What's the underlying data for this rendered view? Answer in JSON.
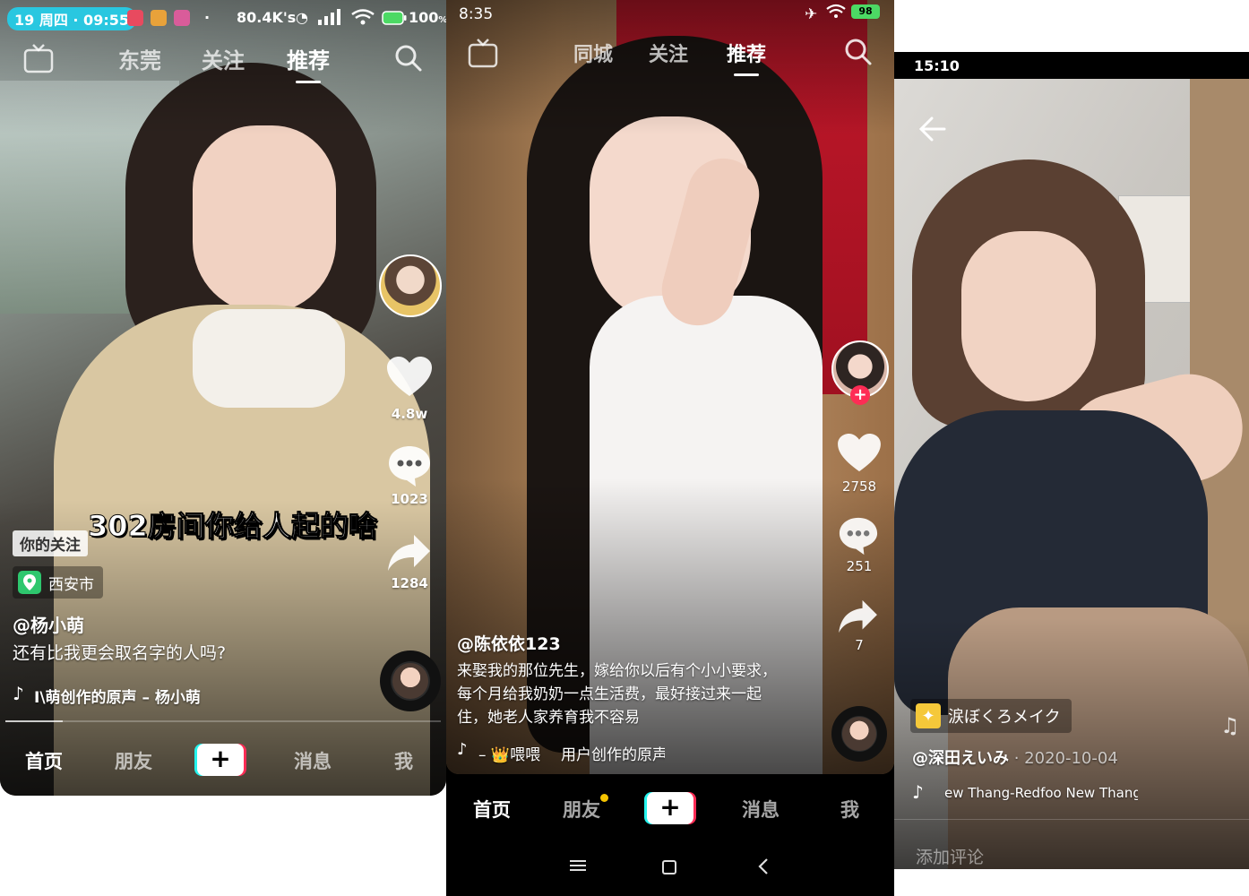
{
  "colors": {
    "accent_red": "#fe2c55",
    "accent_cyan": "#25f4ee",
    "status_pill": "#29c7e0",
    "location_green": "#2ec76e"
  },
  "phone1": {
    "status": {
      "time": "19 周四 · 09:55",
      "speed": "80.4K's",
      "battery": "100"
    },
    "tabs": {
      "live": "直播",
      "city": "东莞",
      "follow": "关注",
      "recommend": "推荐"
    },
    "rail": {
      "likes": "4.8w",
      "comments": "1023",
      "shares": "1284"
    },
    "overlay_text": "302房间你给人起的啥",
    "follow_tag": "你的关注",
    "location": "西安市",
    "handle": "@杨小萌",
    "description": "还有比我更会取名字的人吗?",
    "music": "I\\萌创作的原声 – 杨小萌",
    "nav": {
      "home": "首页",
      "friends": "朋友",
      "messages": "消息",
      "me": "我"
    }
  },
  "phone2": {
    "status": {
      "time": "8:35",
      "battery": "98"
    },
    "tabs": {
      "live": "直播",
      "city": "同城",
      "follow": "关注",
      "recommend": "推荐"
    },
    "rail": {
      "likes": "2758",
      "comments": "251",
      "shares": "7"
    },
    "handle": "@陈依依123",
    "description": "来娶我的那位先生，嫁给你以后有个小小要求，每个月给我奶奶一点生活费，最好接过来一起住，她老人家养育我不容易",
    "music_prefix": "– 👑喂喂",
    "music_title": "用户创作的原声",
    "nav": {
      "home": "首页",
      "friends": "朋友",
      "messages": "消息",
      "me": "我"
    }
  },
  "phone3": {
    "status": {
      "time": "15:10"
    },
    "effect_label": "涙ぼくろメイク",
    "handle": "@深田えいみ",
    "date": " · 2020-10-04",
    "music": "ew Thang-Redfoo    New Thang",
    "comment_placeholder": "添加评论"
  }
}
